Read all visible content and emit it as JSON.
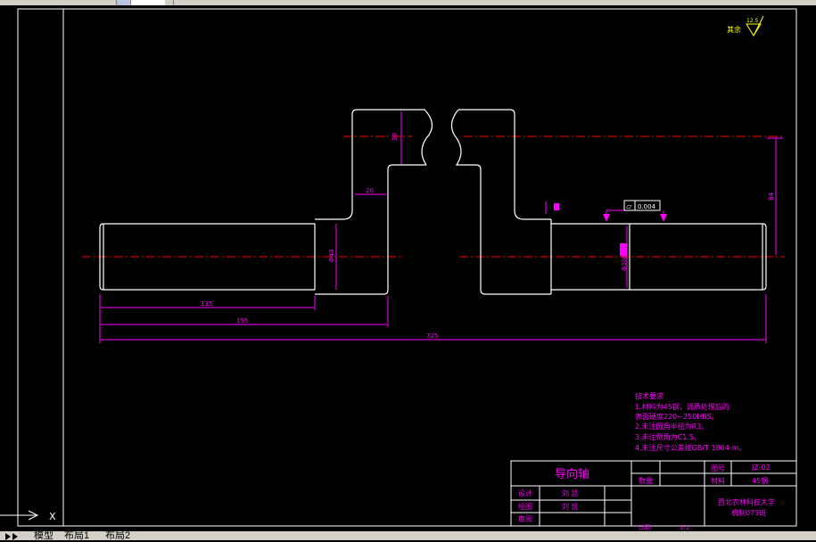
{
  "app": {
    "tool_icons": [
      "window-icon",
      "list-icon",
      "dropdown-icon"
    ]
  },
  "drawing": {
    "roughness_label": "其余",
    "roughness_value": "12.5",
    "flatness_symbol": "▱",
    "flatness_value": "0.004",
    "dimensions": {
      "d_left": "135",
      "d_mid": "155",
      "d_total": "725",
      "d_20": "20",
      "d_h_top": "30",
      "d_h_right": "84",
      "d_dia_left": "Φ40",
      "d_dia_right": "Φ30k6"
    }
  },
  "tech": {
    "title": "技术要求",
    "lines": [
      "1.材料为45钢，调质处理后的",
      "  表面硬度220~250HBS。",
      "2.未注圆角半径为R3。",
      "3.未注倒角为C1.5。",
      "4.未注尺寸公差按GB/T 1804-m。"
    ]
  },
  "title_block": {
    "part_name": "导向轴",
    "drawing_no_label": "图号",
    "drawing_no": "JZ-02",
    "material_label": "材料",
    "material": "45钢",
    "quantity_label": "数量",
    "design_label": "设计",
    "design_name": "刘 凯",
    "draw_label": "绘图",
    "draw_name": "刘 凯",
    "review_label": "审阅",
    "school_line1": "西北农林科技大学",
    "school_line2": "机制073班",
    "scale_label": "比例",
    "scale_value": "1:1"
  },
  "tabs": [
    "模型",
    "布局1",
    "布局2"
  ],
  "ucs": {
    "axis_x": "X"
  },
  "colors": {
    "background": "#000000",
    "outline": "#ffffff",
    "dimension": "#ff00ff",
    "centerline": "#ff0000",
    "text": "#ffff00"
  }
}
